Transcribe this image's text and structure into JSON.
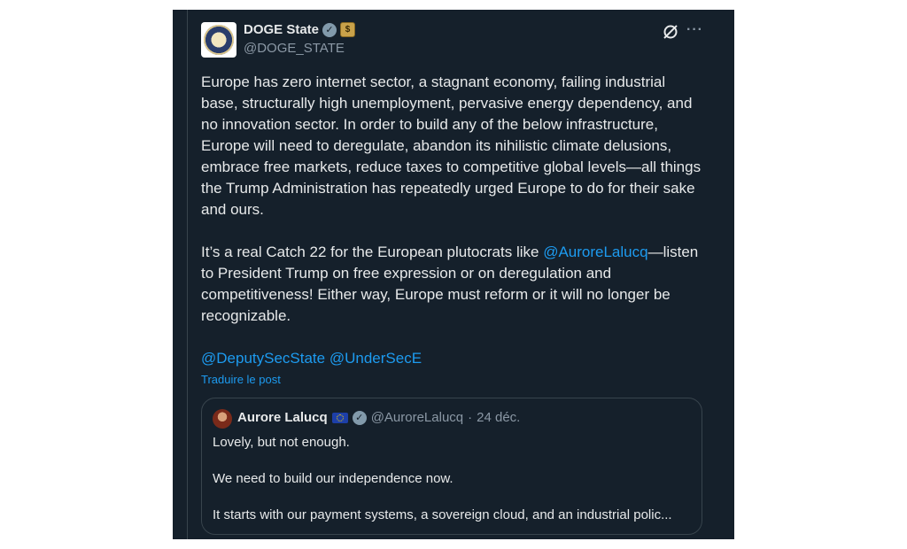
{
  "author": {
    "display_name": "DOGE State",
    "handle": "@DOGE_STATE",
    "avatar": "state-department-seal",
    "verified_badge": "verified-icon",
    "affiliation_badge": "government-affiliation-icon"
  },
  "header_actions": {
    "grok_icon": "grok-icon",
    "more_icon": "more-options-icon",
    "more_label": "···"
  },
  "tweet": {
    "paragraph1": "Europe has zero internet sector, a stagnant economy, failing industrial base, structurally high unemployment, pervasive energy dependency, and no innovation sector. In order to build any of the below infrastructure, Europe will need to deregulate, abandon its nihilistic climate delusions, embrace free markets, reduce taxes to competitive global levels—all things the Trump Administration has repeatedly urged Europe to do for their sake and ours.",
    "paragraph2_before": "It’s a real Catch 22 for the European plutocrats like ",
    "paragraph2_mention": "@AuroreLalucq",
    "paragraph2_after": "—listen to President Trump on free expression or on deregulation and competitiveness! Either way, Europe must reform or it will no longer be recognizable.",
    "mention1": "@DeputySecState",
    "mention2": "@UnderSecE",
    "translate_label": "Traduire le post"
  },
  "quoted_tweet": {
    "display_name": "Aurore Lalucq",
    "flag": "eu-flag",
    "handle": "@AuroreLalucq",
    "separator": "·",
    "date": "24 déc.",
    "line1": "Lovely, but not enough.",
    "line2": "We need to build our independence now.",
    "line3": "It starts with our payment systems, a sovereign cloud, and an industrial polic..."
  },
  "colors": {
    "background": "#15202b",
    "text": "#e7e9ea",
    "secondary": "#8b98a5",
    "link": "#1d9bf0",
    "border": "#38444d"
  }
}
